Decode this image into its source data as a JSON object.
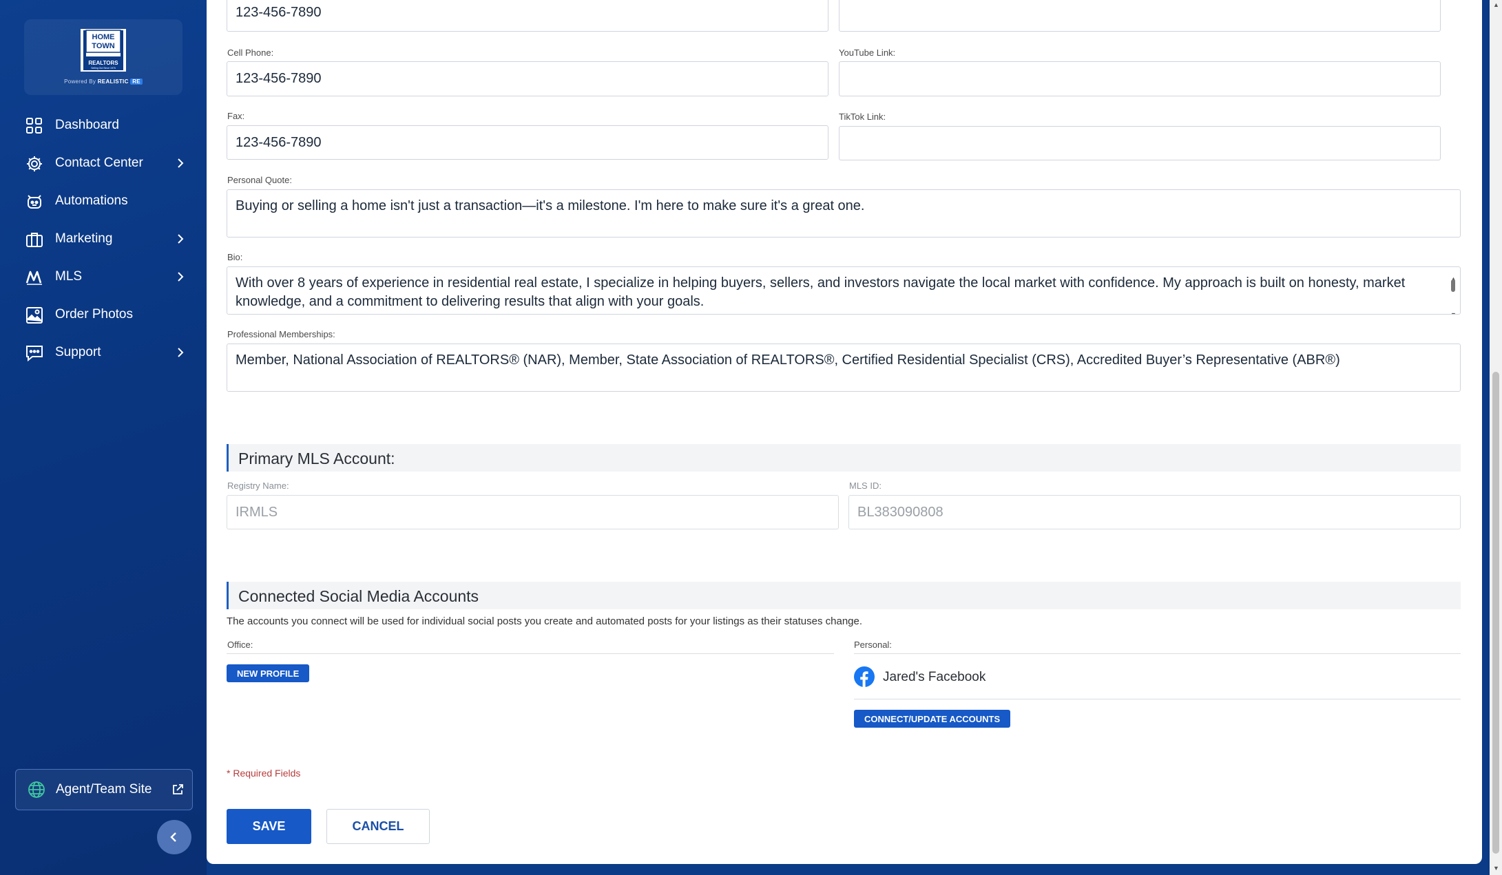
{
  "sidebar": {
    "logo": {
      "line1": "HOME",
      "line2": "TOWN",
      "line3": "REALTORS",
      "tagline": "Selling Out Since 1976",
      "powered_by": "Powered By",
      "brand": "REALISTIC",
      "brand_badge": "RE"
    },
    "items": [
      {
        "label": "Dashboard",
        "icon": "grid-icon",
        "has_submenu": false
      },
      {
        "label": "Contact Center",
        "icon": "gear-icon",
        "has_submenu": true
      },
      {
        "label": "Automations",
        "icon": "robot-icon",
        "has_submenu": false
      },
      {
        "label": "Marketing",
        "icon": "briefcase-icon",
        "has_submenu": true
      },
      {
        "label": "MLS",
        "icon": "mls-icon",
        "has_submenu": true
      },
      {
        "label": "Order Photos",
        "icon": "photo-icon",
        "has_submenu": false
      },
      {
        "label": "Support",
        "icon": "chat-icon",
        "has_submenu": true
      }
    ],
    "agent_site_label": "Agent/Team Site"
  },
  "form": {
    "phone": {
      "value": "123-456-7890"
    },
    "cell_phone": {
      "label": "Cell Phone:",
      "value": "123-456-7890"
    },
    "youtube": {
      "label": "YouTube Link:",
      "value": ""
    },
    "fax": {
      "label": "Fax:",
      "value": "123-456-7890"
    },
    "tiktok": {
      "label": "TikTok Link:",
      "value": ""
    },
    "quote": {
      "label": "Personal Quote:",
      "value": "Buying or selling a home isn't just a transaction—it's a milestone. I'm here to make sure it's a great one."
    },
    "bio": {
      "label": "Bio:",
      "value": "With over 8 years of experience in residential real estate, I specialize in helping buyers, sellers, and investors navigate the local market with confidence. My approach is built on honesty, market knowledge, and a commitment to delivering results that align with your goals."
    },
    "memberships": {
      "label": "Professional Memberships:",
      "value": "Member, National Association of REALTORS® (NAR), Member, State Association of REALTORS®, Certified Residential Specialist (CRS), Accredited Buyer’s Representative (ABR®)"
    }
  },
  "mls": {
    "title": "Primary MLS Account:",
    "registry_label": "Registry Name:",
    "registry_value": "IRMLS",
    "mls_id_label": "MLS ID:",
    "mls_id_value": "BL383090808"
  },
  "social": {
    "title": "Connected Social Media Accounts",
    "description": "The accounts you connect will be used for individual social posts you create and automated posts for your listings as their statuses change.",
    "office_label": "Office:",
    "new_profile_label": "NEW PROFILE",
    "personal_label": "Personal:",
    "facebook_account": "Jared's Facebook",
    "connect_label": "CONNECT/UPDATE ACCOUNTS"
  },
  "footer": {
    "required_note": "* Required Fields",
    "save_label": "SAVE",
    "cancel_label": "CANCEL"
  },
  "colors": {
    "accent": "#1659c7",
    "sidebar": "#0b3a86",
    "facebook": "#1877f2",
    "required": "#b63c3c"
  }
}
